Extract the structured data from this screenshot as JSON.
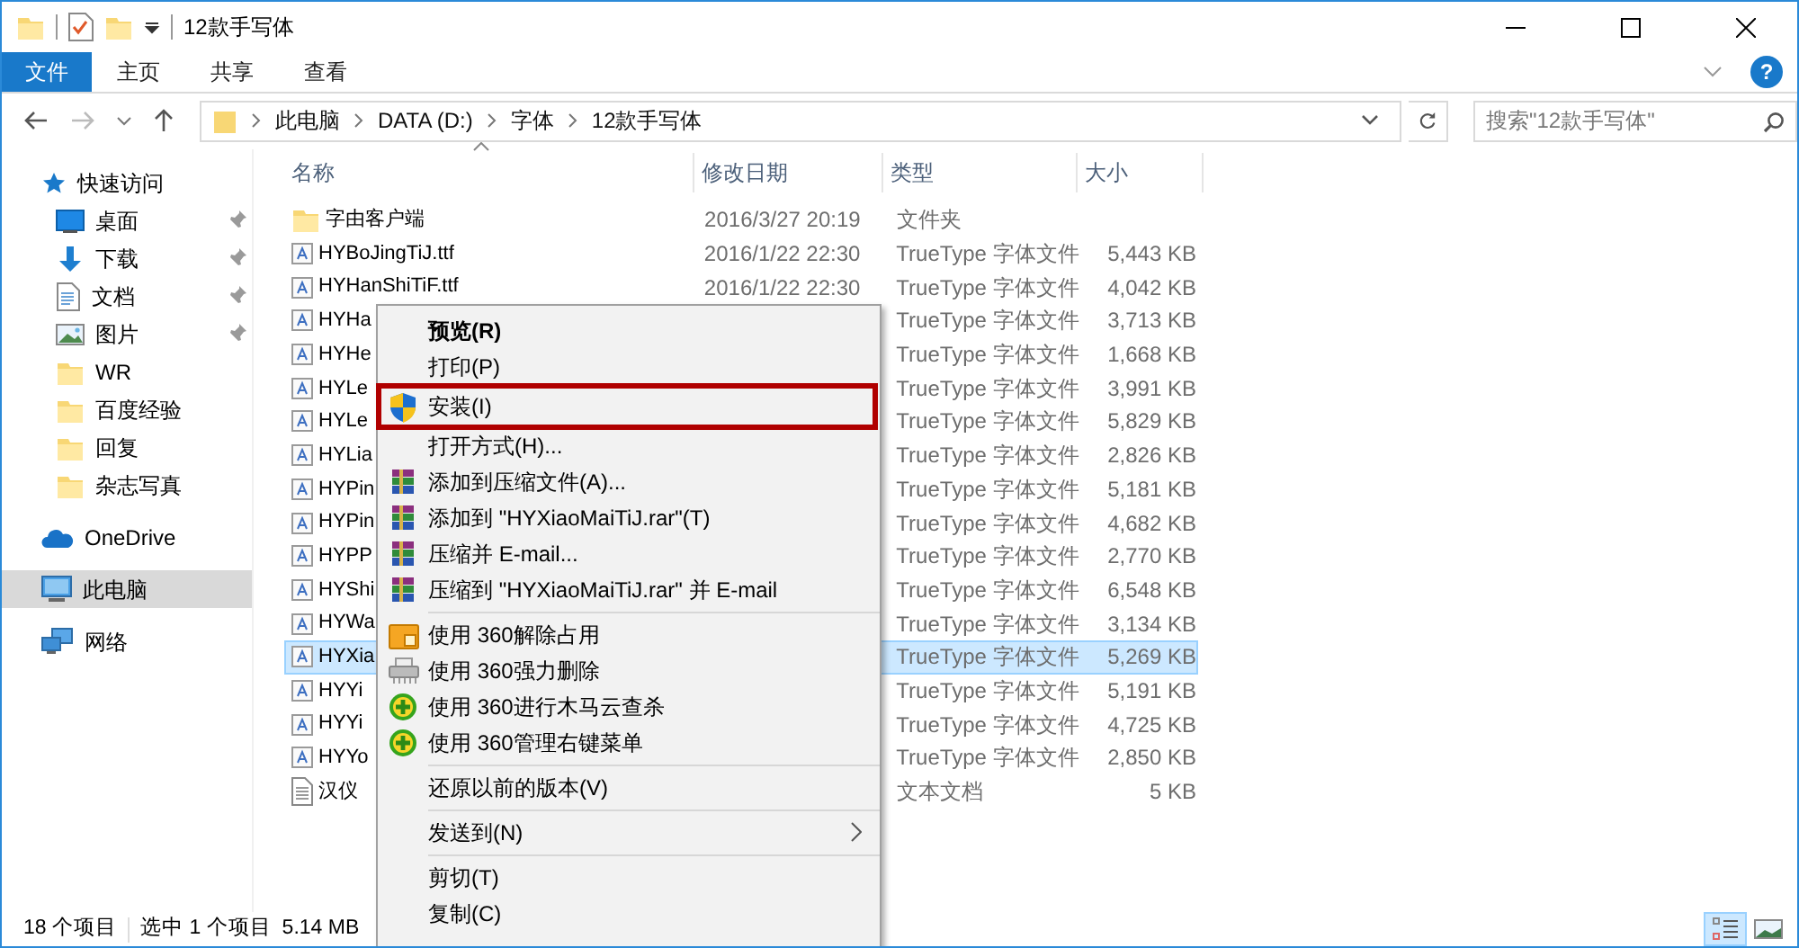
{
  "window": {
    "title": "12款手写体"
  },
  "ribbon_tabs": [
    {
      "label": "文件",
      "kind": "file"
    },
    {
      "label": "主页",
      "kind": "tab"
    },
    {
      "label": "共享",
      "kind": "tab"
    },
    {
      "label": "查看",
      "kind": "tab"
    }
  ],
  "help_button": "?",
  "address": {
    "crumbs": [
      "此电脑",
      "DATA (D:)",
      "字体",
      "12款手写体"
    ]
  },
  "search": {
    "placeholder": "搜索\"12款手写体\""
  },
  "sidebar": {
    "items": [
      {
        "label": "快速访问",
        "selected": false,
        "children": [
          {
            "label": "桌面",
            "pinned": true
          },
          {
            "label": "下载",
            "pinned": true
          },
          {
            "label": "文档",
            "pinned": true
          },
          {
            "label": "图片",
            "pinned": true
          },
          {
            "label": "WR",
            "pinned": false
          },
          {
            "label": "百度经验",
            "pinned": false
          },
          {
            "label": "回复",
            "pinned": false
          },
          {
            "label": "杂志写真",
            "pinned": false
          }
        ]
      },
      {
        "label": "OneDrive",
        "selected": false
      },
      {
        "label": "此电脑",
        "selected": true
      },
      {
        "label": "网络",
        "selected": false
      }
    ]
  },
  "table": {
    "columns": [
      "名称",
      "修改日期",
      "类型",
      "大小"
    ],
    "rows": [
      {
        "name": "字由客户端",
        "date": "2016/3/27 20:19",
        "type": "文件夹",
        "selected": false
      },
      {
        "name": "HYBoJingTiJ.ttf",
        "date": "2016/1/22 22:30",
        "type": "TrueType 字体文件",
        "size": "5,443 KB",
        "selected": false
      },
      {
        "name": "HYHanShiTiF.ttf",
        "date": "2016/1/22 22:30",
        "type": "TrueType 字体文件",
        "size": "4,042 KB",
        "selected": false
      },
      {
        "name": "HYHa",
        "type": "TrueType 字体文件",
        "size": "3,713 KB",
        "selected": false
      },
      {
        "name": "HYHe",
        "type": "TrueType 字体文件",
        "size": "1,668 KB",
        "selected": false
      },
      {
        "name": "HYLe",
        "type": "TrueType 字体文件",
        "size": "3,991 KB",
        "selected": false
      },
      {
        "name": "HYLe",
        "type": "TrueType 字体文件",
        "size": "5,829 KB",
        "selected": false
      },
      {
        "name": "HYLia",
        "type": "TrueType 字体文件",
        "size": "2,826 KB",
        "selected": false
      },
      {
        "name": "HYPin",
        "type": "TrueType 字体文件",
        "size": "5,181 KB",
        "selected": false
      },
      {
        "name": "HYPin",
        "type": "TrueType 字体文件",
        "size": "4,682 KB",
        "selected": false
      },
      {
        "name": "HYPP",
        "type": "TrueType 字体文件",
        "size": "2,770 KB",
        "selected": false
      },
      {
        "name": "HYShi",
        "type": "TrueType 字体文件",
        "size": "6,548 KB",
        "selected": false
      },
      {
        "name": "HYWa",
        "type": "TrueType 字体文件",
        "size": "3,134 KB",
        "selected": false
      },
      {
        "name": "HYXia",
        "type": "TrueType 字体文件",
        "size": "5,269 KB",
        "selected": true
      },
      {
        "name": "HYYi",
        "type": "TrueType 字体文件",
        "size": "5,191 KB",
        "selected": false
      },
      {
        "name": "HYYi",
        "type": "TrueType 字体文件",
        "size": "4,725 KB",
        "selected": false
      },
      {
        "name": "HYYo",
        "type": "TrueType 字体文件",
        "size": "2,850 KB",
        "selected": false
      },
      {
        "name": "汉仪",
        "type": "文本文档",
        "size": "5 KB",
        "selected": false
      }
    ]
  },
  "context_menu": {
    "items": [
      {
        "kind": "item",
        "label": "预览(R)",
        "default": true
      },
      {
        "kind": "item",
        "label": "打印(P)",
        "default": false
      },
      {
        "kind": "item",
        "label": "安装(I)",
        "default": false,
        "highlighted": true
      },
      {
        "kind": "item",
        "label": "打开方式(H)...",
        "default": false
      },
      {
        "kind": "item",
        "label": "添加到压缩文件(A)...",
        "default": false
      },
      {
        "kind": "item",
        "label": "添加到 \"HYXiaoMaiTiJ.rar\"(T)",
        "default": false
      },
      {
        "kind": "item",
        "label": "压缩并 E-mail...",
        "default": false
      },
      {
        "kind": "item",
        "label": "压缩到 \"HYXiaoMaiTiJ.rar\" 并 E-mail",
        "default": false
      },
      {
        "kind": "separator"
      },
      {
        "kind": "item",
        "label": "使用 360解除占用",
        "default": false
      },
      {
        "kind": "item",
        "label": "使用 360强力删除",
        "default": false
      },
      {
        "kind": "item",
        "label": "使用 360进行木马云查杀",
        "default": false
      },
      {
        "kind": "item",
        "label": "使用 360管理右键菜单",
        "default": false
      },
      {
        "kind": "separator"
      },
      {
        "kind": "item",
        "label": "还原以前的版本(V)",
        "default": false
      },
      {
        "kind": "separator"
      },
      {
        "kind": "item",
        "label": "发送到(N)",
        "default": false,
        "submenu": true
      },
      {
        "kind": "separator"
      },
      {
        "kind": "item",
        "label": "剪切(T)",
        "default": false
      },
      {
        "kind": "item",
        "label": "复制(C)",
        "default": false
      }
    ]
  },
  "status_bar": {
    "count": "18 个项目",
    "selection": "选中 1 个项目",
    "size": "5.14 MB"
  },
  "view_buttons": [
    {
      "kind": "details",
      "selected": true
    },
    {
      "kind": "thumbnails",
      "selected": false
    }
  ]
}
